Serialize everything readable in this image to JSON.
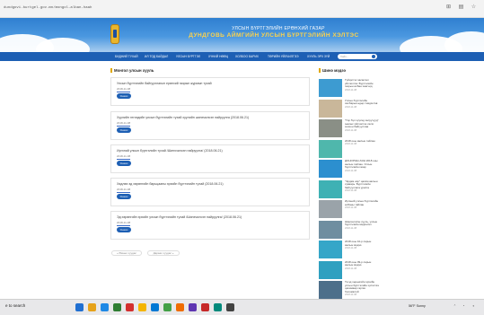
{
  "browser": {
    "url": "dundgovi.burtgel.gov.mn/mongol-alban-haah"
  },
  "header": {
    "title_line1": "УЛСЫН БҮРТГЭЛИЙН ЕРӨНХИЙ ГАЗАР",
    "title_line2": "ДУНДГОВЬ АЙМГИЙН УЛСЫН БҮРТГЭЛИЙН ХЭЛТЭС"
  },
  "nav": {
    "items": [
      "БИДНИЙ ТУХАЙ",
      "ИЛ ТОД БАЙДАЛ",
      "УЛСЫН БҮРТГЭЛ",
      "ХҮНИЙ НӨӨЦ",
      "ХОЛБОО БАРИХ",
      "ТӨРИЙН ҮЙЛЧИЛГЭЭ",
      "ХУУЛЬ ЭРХ ЗҮЙ"
    ],
    "search_placeholder": "Хайх..."
  },
  "main": {
    "heading": "Монгол улсын хууль",
    "list": [
      {
        "title": "Улсын бүртгэлийн байгууллагын ерөнхий газрын журмын тухай",
        "date": "2018-11-08",
        "button": "Унших"
      },
      {
        "title": "Хуулийн этгээдийн улсын бүртгэлийн тухай хуулийн шинэчилсэн найруулга (2018.06.21)",
        "date": "2018-11-08",
        "button": "Унших"
      },
      {
        "title": "Иргэний улсын бүртгэлийн тухай /Шинэчилсэн найруулга/ (2018.06.21)",
        "date": "2018-11-08",
        "button": "Унших"
      },
      {
        "title": "Хөдлөх эд хөрөнгийн барьцааны эрхийн бүртгэлийн тухай (2018.06.21)",
        "date": "2018-11-08",
        "button": "Унших"
      },
      {
        "title": "Эд хөрөнгийн эрхийн улсын бүртгэлийн тухай /Шинэчилсэн найруулга/ (2018.06.21)",
        "date": "2018-11-08",
        "button": "Унших"
      }
    ],
    "pager_prev": "« Өмнөх хуудас",
    "pager_next": "Дараах хуудас »"
  },
  "sidebar": {
    "heading": "Шинэ мэдээ",
    "news": [
      {
        "text": "Гүйцэтгэх засаглал үйлчилгээ: Бүртгэлийн газрын албан хаагчид",
        "date": "2018-11-08",
        "color": "#3d9bd1"
      },
      {
        "text": "Улсын бүртгэлийн салбарын өдөр тэмдэглэв",
        "date": "2018-11-08",
        "color": "#c9b79a"
      },
      {
        "text": "\"Гэр бүл хүүхэд залуучууд\" зөвлөх үйлчилгээ хэсэг зохион байгууллаа",
        "date": "2018-11-08",
        "color": "#8a8f86"
      },
      {
        "text": "2018 оны ажлын тайлан",
        "date": "2018-11-08",
        "color": "#4fb7ac"
      },
      {
        "text": "ДОНОРЫН АЯН 2018 оны ажлын тайлан. Улсын бүртгэлийн газар",
        "date": "2018-11-08",
        "color": "#2c8fcf"
      },
      {
        "text": "\"Эрдэм нэр\" цахим ажлын хуваарь: Бүртгэлийн байгууллага урилга",
        "date": "2018-11-08",
        "color": "#3eb1b4"
      },
      {
        "text": "Иргэний улсын бүртгэлийн албаны тайлан",
        "date": "2018-11-08",
        "color": "#9aa3a9"
      },
      {
        "text": "Шинэчилсэн хууль, улсын бүртгэлийн мэдээлэл",
        "date": "2018-11-08",
        "color": "#6f8ea0"
      },
      {
        "text": "2018 оны 10-р сарын ажлын мэдээ",
        "date": "2018-11-08",
        "color": "#35a6c8"
      },
      {
        "text": "2018 оны 09-р сарын ажлын мэдээ",
        "date": "2018-11-08",
        "color": "#2fa0c0"
      },
      {
        "text": "Та эд хөрөнгийн эрхийн улсын бүртгэлийн хүсэлтээ цахимаар гаргах боломжтой",
        "date": "2018-11-08",
        "color": "#4d6f8a"
      }
    ]
  },
  "taskbar": {
    "search_text": "e to search",
    "weather": "56°F Sunny",
    "colors": [
      "#1f6fd1",
      "#e6a21a",
      "#1e88e5",
      "#2e7d32",
      "#d32f2f",
      "#f4b400",
      "#0078d4",
      "#43a047",
      "#ef6c00",
      "#5e35b1",
      "#c62828",
      "#00897b",
      "#424242"
    ]
  }
}
